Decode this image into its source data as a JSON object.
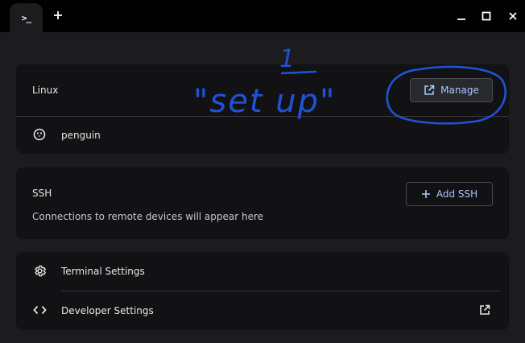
{
  "titlebar": {
    "tab_icon_text": ">_",
    "tab_icon": "terminal-icon",
    "new_tab_icon": "plus-icon",
    "window_controls": [
      "minimize-icon",
      "maximize-icon",
      "close-icon"
    ]
  },
  "linux": {
    "heading": "Linux",
    "manage_label": "Manage",
    "manage_icon": "open-external-icon",
    "container_name": "penguin",
    "container_icon": "penguin-icon"
  },
  "ssh": {
    "heading": "SSH",
    "add_label": "Add SSH",
    "add_icon": "plus-icon",
    "empty_message": "Connections to remote devices will appear here"
  },
  "settings": {
    "terminal_label": "Terminal Settings",
    "terminal_icon": "gear-icon",
    "developer_label": "Developer Settings",
    "developer_icon": "code-brackets-icon",
    "developer_trailing_icon": "open-external-icon"
  },
  "annotation": {
    "number": "1",
    "text": "\"set up\"",
    "ink_color": "#1f53d6"
  },
  "colors": {
    "background": "#1c1c1e",
    "card": "#121214",
    "accent": "#a8c7fa"
  }
}
